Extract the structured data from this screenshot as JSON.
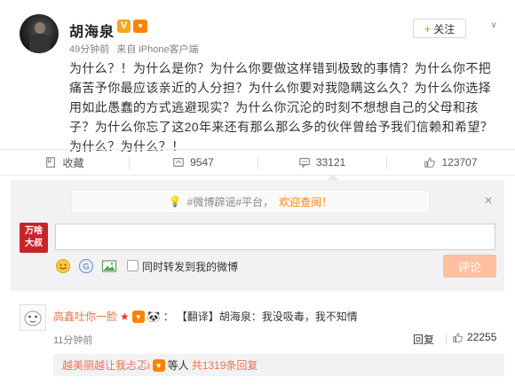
{
  "post": {
    "username": "胡海泉",
    "verified_badge": "V",
    "member_badge": "vip-icon",
    "time_ago": "49分钟前",
    "source": "来自 iPhone客户端",
    "follow_label": "关注",
    "content": "为什么？！为什么是你？为什么你要做这样错到极致的事情？为什么你不把痛苦予你最应该亲近的人分担？为什么你要对我隐瞒这么久？为什么你选择用如此愚蠢的方式逃避现实？为什么你沉沦的时刻不想想自己的父母和孩子？为什么你忘了这20年来还有那么那么多的伙伴曾给予我们信赖和希望？为什么？为什么？！"
  },
  "actions": {
    "favorite_label": "收藏",
    "repost_count": "9547",
    "comment_count": "33121",
    "like_count": "123707"
  },
  "composer": {
    "notice_prefix": "#微博辟谣#平台，",
    "notice_link": "欢迎查阅！",
    "user_pic_text": "万啥大叔",
    "input_value": "",
    "repost_label": "同时转发到我的微博",
    "submit_label": "评论"
  },
  "comment": {
    "name": "高鑫吐你一脸",
    "text": "【翻译】胡海泉：我没吸毒，我不知情",
    "time": "11分钟前",
    "reply_label": "回复",
    "like_count": "22255",
    "subreply_name": "越美丽越让我忐忑i",
    "subreply_mid": "等人",
    "subreply_count": "共1319条回复"
  },
  "colors": {
    "accent": "#ff8200",
    "link_orange": "#eb7350",
    "panel_bg": "#f2f2f5",
    "submit_disabled": "#ffc09f"
  }
}
